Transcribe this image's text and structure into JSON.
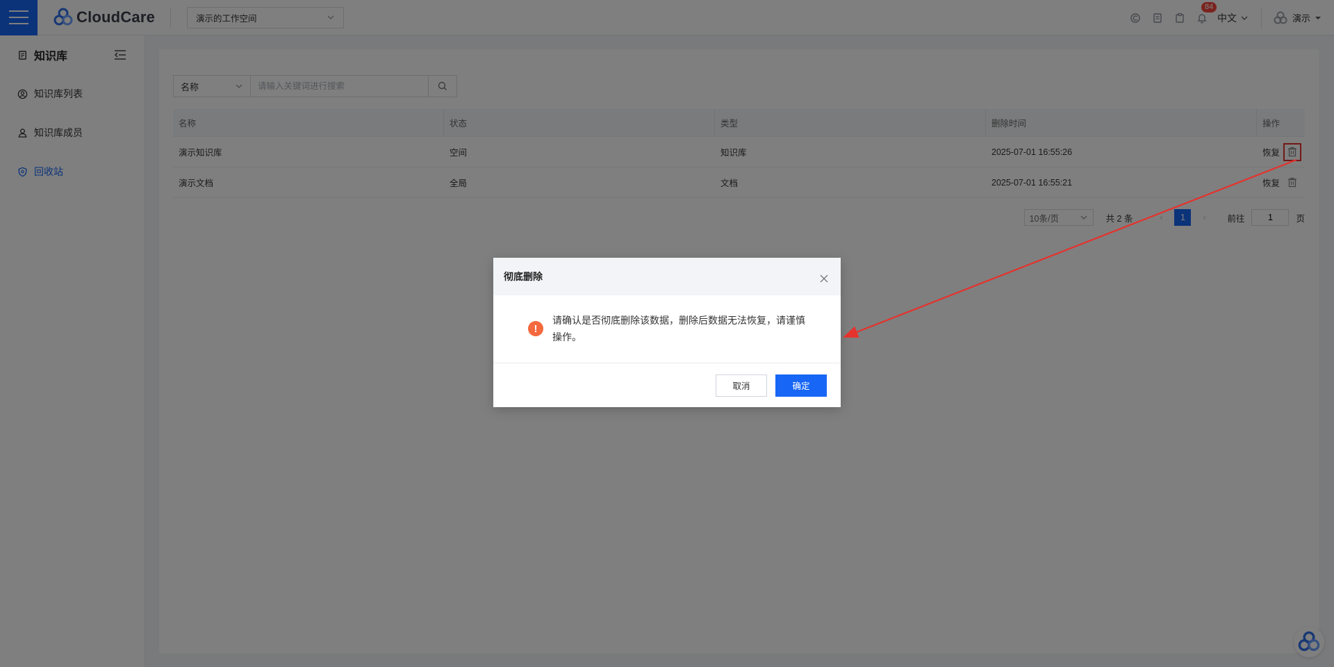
{
  "header": {
    "logo_text": "CloudCare",
    "workspace": "演示的工作空间",
    "notification_count": "84",
    "language": "中文",
    "user_name": "演示",
    "icons": [
      "copy-icon",
      "document-icon",
      "clipboard-icon",
      "bell-icon"
    ]
  },
  "sidebar": {
    "title": "知识库",
    "items": [
      {
        "label": "知识库列表",
        "icon": "user-circle-icon"
      },
      {
        "label": "知识库成员",
        "icon": "members-icon"
      },
      {
        "label": "回收站",
        "icon": "shield-icon",
        "active": true
      }
    ]
  },
  "search": {
    "field": "名称",
    "placeholder": "请输入关键词进行搜索"
  },
  "table": {
    "columns": [
      "名称",
      "状态",
      "类型",
      "删除时间",
      "操作"
    ],
    "rows": [
      {
        "name": "演示知识库",
        "status": "空间",
        "type": "知识库",
        "deleted_at": "2025-07-01 16:55:26",
        "restore": "恢复"
      },
      {
        "name": "演示文档",
        "status": "全局",
        "type": "文档",
        "deleted_at": "2025-07-01 16:55:21",
        "restore": "恢复"
      }
    ]
  },
  "pagination": {
    "page_size": "10条/页",
    "total": "共 2 条",
    "current_page": "1",
    "goto_label": "前往",
    "goto_value": "1",
    "page_suffix": "页"
  },
  "modal": {
    "title": "彻底删除",
    "message": "请确认是否彻底删除该数据，删除后数据无法恢复，请谨慎操作。",
    "cancel": "取消",
    "confirm": "确定"
  },
  "colors": {
    "primary": "#1766f5",
    "warning": "#f4693d",
    "annotation": "#e5322d",
    "badge": "#f5463c"
  }
}
